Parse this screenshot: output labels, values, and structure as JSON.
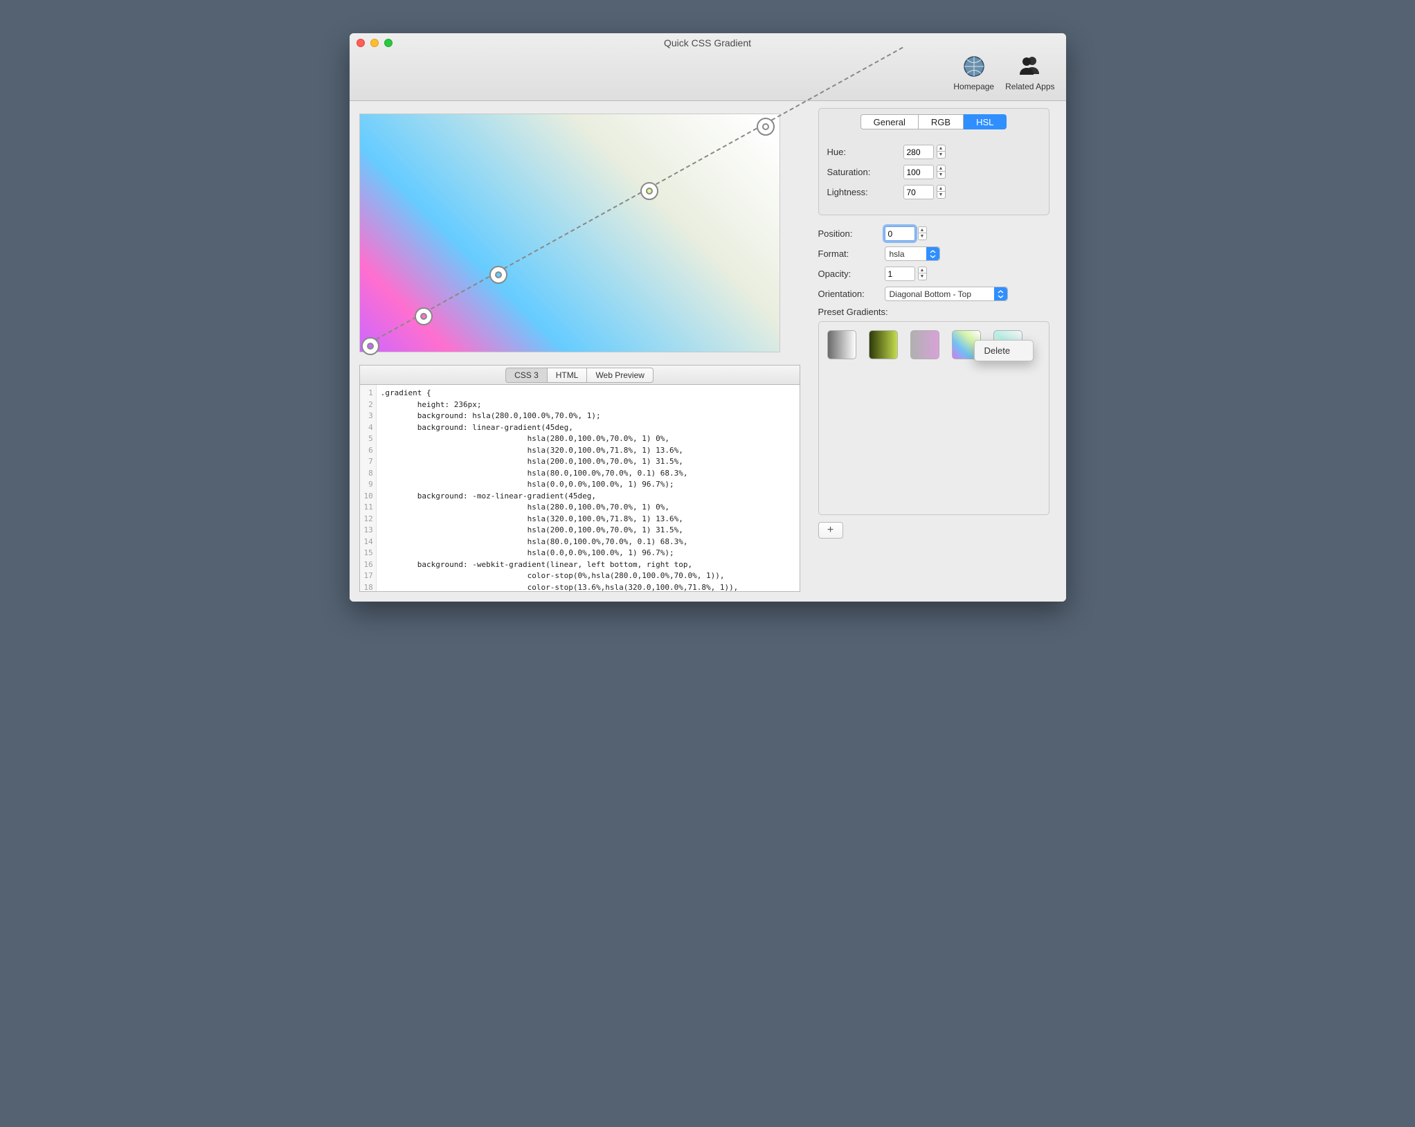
{
  "window": {
    "title": "Quick CSS Gradient"
  },
  "toolbar": {
    "homepage_label": "Homepage",
    "related_label": "Related Apps"
  },
  "color_tabs": [
    "General",
    "RGB",
    "HSL"
  ],
  "color_tabs_active": "HSL",
  "hsl": {
    "hue_label": "Hue:",
    "hue_value": "280",
    "sat_label": "Saturation:",
    "sat_value": "100",
    "light_label": "Lightness:",
    "light_value": "70"
  },
  "controls": {
    "position_label": "Position:",
    "position_value": "0",
    "format_label": "Format:",
    "format_value": "hsla",
    "opacity_label": "Opacity:",
    "opacity_value": "1",
    "orientation_label": "Orientation:",
    "orientation_value": "Diagonal Bottom - Top"
  },
  "presets_label": "Preset Gradients:",
  "ctx_menu": {
    "delete": "Delete"
  },
  "code_tabs": [
    "CSS 3",
    "HTML",
    "Web Preview"
  ],
  "code_tabs_active": "CSS 3",
  "code_lines": [
    ".gradient {",
    "        height: 236px;",
    "        background: hsla(280.0,100.0%,70.0%, 1);",
    "        background: linear-gradient(45deg,",
    "                                hsla(280.0,100.0%,70.0%, 1) 0%,",
    "                                hsla(320.0,100.0%,71.8%, 1) 13.6%,",
    "                                hsla(200.0,100.0%,70.0%, 1) 31.5%,",
    "                                hsla(80.0,100.0%,70.0%, 0.1) 68.3%,",
    "                                hsla(0.0,0.0%,100.0%, 1) 96.7%);",
    "        background: -moz-linear-gradient(45deg,",
    "                                hsla(280.0,100.0%,70.0%, 1) 0%,",
    "                                hsla(320.0,100.0%,71.8%, 1) 13.6%,",
    "                                hsla(200.0,100.0%,70.0%, 1) 31.5%,",
    "                                hsla(80.0,100.0%,70.0%, 0.1) 68.3%,",
    "                                hsla(0.0,0.0%,100.0%, 1) 96.7%);",
    "        background: -webkit-gradient(linear, left bottom, right top,",
    "                                color-stop(0%,hsla(280.0,100.0%,70.0%, 1)),",
    "                                color-stop(13.6%,hsla(320.0,100.0%,71.8%, 1)),"
  ]
}
